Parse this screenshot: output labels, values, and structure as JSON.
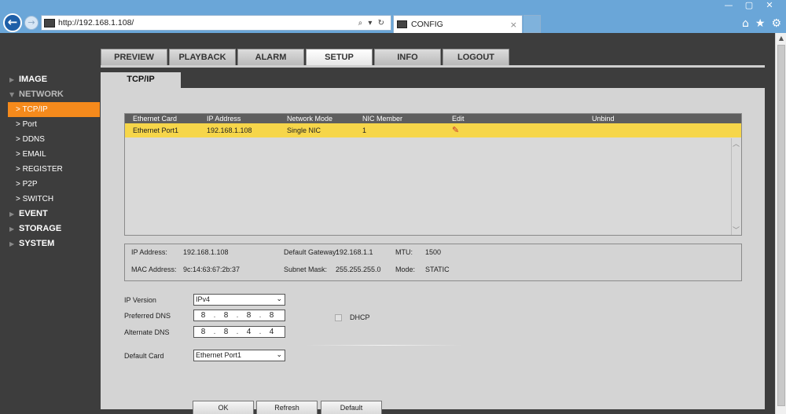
{
  "browser": {
    "window_controls": [
      "—",
      "▢",
      "✕"
    ],
    "url": "http://192.168.1.108/",
    "address_tools": "⌕ ▾ ↻",
    "tab_title": "CONFIG",
    "tab_close": "×",
    "icons": [
      "home-icon",
      "star-icon",
      "gear-icon"
    ]
  },
  "nav": {
    "tabs": [
      "PREVIEW",
      "PLAYBACK",
      "ALARM",
      "SETUP",
      "INFO",
      "LOGOUT"
    ],
    "active": "SETUP"
  },
  "sidebar": {
    "image": "IMAGE",
    "network": "NETWORK",
    "network_items": [
      "> TCP/IP",
      "> Port",
      "> DDNS",
      "> EMAIL",
      "> REGISTER",
      "> P2P",
      "> SWITCH"
    ],
    "active_item": "TCP/IP",
    "event": "EVENT",
    "storage": "STORAGE",
    "system": "SYSTEM"
  },
  "subtab": "TCP/IP",
  "card_table": {
    "headers": [
      "Ethernet Card",
      "IP Address",
      "Network Mode",
      "NIC Member",
      "Edit",
      "Unbind"
    ],
    "rows": [
      {
        "card": "Ethernet Port1",
        "ip": "192.168.1.108",
        "mode": "Single NIC",
        "member": "1"
      }
    ]
  },
  "info": {
    "ip_label": "IP Address:",
    "ip_value": "192.168.1.108",
    "gateway_label": "Default Gateway:",
    "gateway_value": "192.168.1.1",
    "mtu_label": "MTU:",
    "mtu_value": "1500",
    "mac_label": "MAC Address:",
    "mac_value": "9c:14:63:67:2b:37",
    "mask_label": "Subnet Mask:",
    "mask_value": "255.255.255.0",
    "mode_label": "Mode:",
    "mode_value": "STATIC"
  },
  "form": {
    "ip_version_label": "IP Version",
    "ip_version_value": "IPv4",
    "preferred_dns_label": "Preferred DNS",
    "preferred_dns": [
      "8",
      "8",
      "8",
      "8"
    ],
    "alternate_dns_label": "Alternate DNS",
    "alternate_dns": [
      "8",
      "8",
      "4",
      "4"
    ],
    "dhcp_label": "DHCP",
    "default_card_label": "Default Card",
    "default_card_value": "Ethernet Port1"
  },
  "buttons": {
    "ok": "OK",
    "refresh": "Refresh",
    "default": "Default"
  }
}
